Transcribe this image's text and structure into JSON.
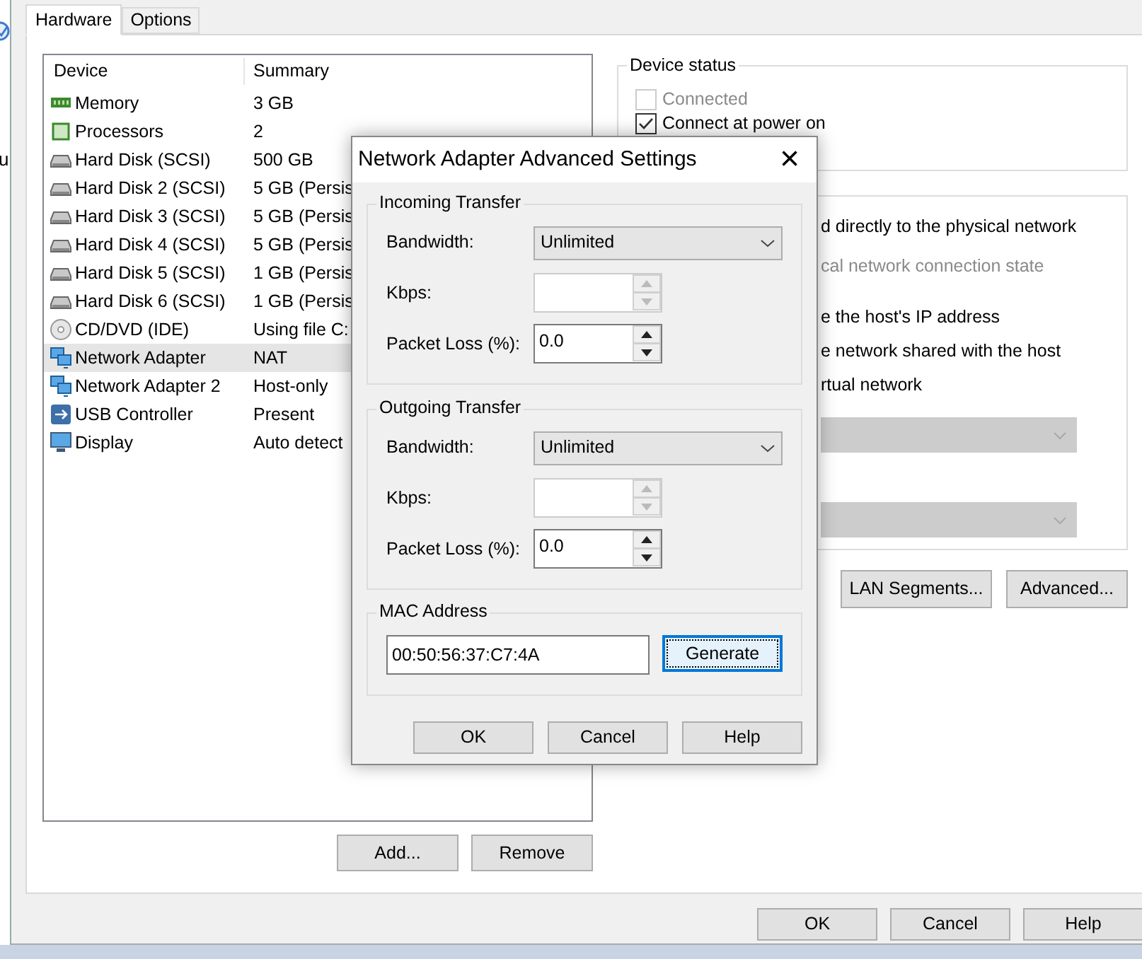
{
  "background_window": {
    "fragments": [
      "u"
    ]
  },
  "tabs": [
    {
      "label": "Hardware",
      "selected": true
    },
    {
      "label": "Options",
      "selected": false
    }
  ],
  "device_list": {
    "columns": [
      "Device",
      "Summary"
    ],
    "rows": [
      {
        "kind": "memory",
        "device": "Memory",
        "summary": "3 GB",
        "selected": false
      },
      {
        "kind": "cpu",
        "device": "Processors",
        "summary": "2",
        "selected": false
      },
      {
        "kind": "disk",
        "device": "Hard Disk (SCSI)",
        "summary": "500 GB",
        "selected": false
      },
      {
        "kind": "disk",
        "device": "Hard Disk 2 (SCSI)",
        "summary": "5 GB (Persis",
        "selected": false
      },
      {
        "kind": "disk",
        "device": "Hard Disk 3 (SCSI)",
        "summary": "5 GB (Persis",
        "selected": false
      },
      {
        "kind": "disk",
        "device": "Hard Disk 4 (SCSI)",
        "summary": "5 GB (Persis",
        "selected": false
      },
      {
        "kind": "disk",
        "device": "Hard Disk 5 (SCSI)",
        "summary": "1 GB (Persis",
        "selected": false
      },
      {
        "kind": "disk",
        "device": "Hard Disk 6 (SCSI)",
        "summary": "1 GB (Persis",
        "selected": false
      },
      {
        "kind": "cd",
        "device": "CD/DVD (IDE)",
        "summary": "Using file C:",
        "selected": false
      },
      {
        "kind": "network",
        "device": "Network Adapter",
        "summary": "NAT",
        "selected": true
      },
      {
        "kind": "network",
        "device": "Network Adapter 2",
        "summary": "Host-only",
        "selected": false
      },
      {
        "kind": "usb",
        "device": "USB Controller",
        "summary": "Present",
        "selected": false
      },
      {
        "kind": "display",
        "device": "Display",
        "summary": "Auto detect",
        "selected": false
      }
    ]
  },
  "list_buttons": [
    "Add...",
    "Remove"
  ],
  "device_status": {
    "title": "Device status",
    "options": [
      {
        "label": "Connected",
        "checked": false,
        "disabled": true
      },
      {
        "label": "Connect at power on",
        "checked": true,
        "disabled": false
      }
    ]
  },
  "network_connection": {
    "lines": [
      {
        "text": "d directly to the physical network",
        "disabled": false
      },
      {
        "text": "cal network connection state",
        "disabled": true
      },
      {
        "text": "e the host's IP address",
        "disabled": false
      },
      {
        "text": "e network shared with the host",
        "disabled": false
      },
      {
        "text": "rtual network",
        "disabled": false
      }
    ],
    "dropdowns": [
      {
        "disabled": true
      },
      {
        "disabled": true
      }
    ]
  },
  "panel_buttons": [
    "LAN Segments...",
    "Advanced..."
  ],
  "window_buttons": [
    "OK",
    "Cancel",
    "Help"
  ],
  "dialog": {
    "title": "Network Adapter Advanced Settings",
    "close": "×",
    "groups": [
      {
        "title": "Incoming Transfer",
        "bandwidth_label": "Bandwidth:",
        "bandwidth": "Unlimited",
        "kbps_label": "Kbps:",
        "kbps": {
          "disabled": true
        },
        "loss_label": "Packet Loss (%):",
        "loss": {
          "value": "0.0",
          "disabled": false
        }
      },
      {
        "title": "Outgoing Transfer",
        "bandwidth_label": "Bandwidth:",
        "bandwidth": "Unlimited",
        "kbps_label": "Kbps:",
        "kbps": {
          "disabled": true
        },
        "loss_label": "Packet Loss (%):",
        "loss": {
          "value": "0.0",
          "disabled": false
        }
      }
    ],
    "mac": {
      "title": "MAC Address",
      "value": "00:50:56:37:C7:4A",
      "button": "Generate"
    },
    "buttons": [
      "OK",
      "Cancel",
      "Help"
    ]
  }
}
